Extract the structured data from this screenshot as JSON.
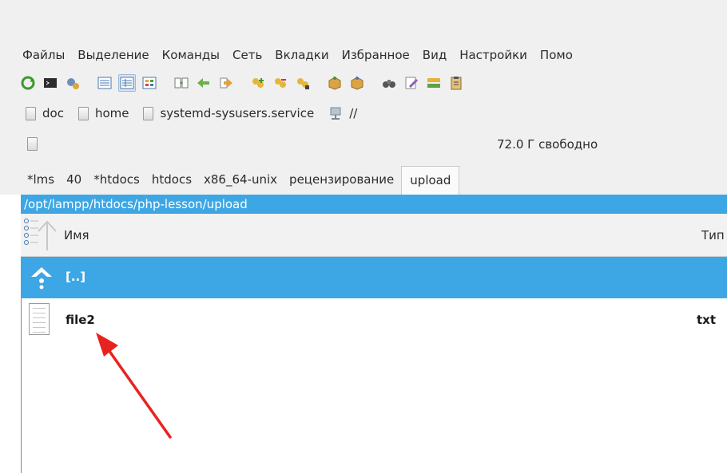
{
  "menu": [
    "Файлы",
    "Выделение",
    "Команды",
    "Сеть",
    "Вкладки",
    "Избранное",
    "Вид",
    "Настройки",
    "Помо"
  ],
  "drives": [
    {
      "label": "doc"
    },
    {
      "label": "home"
    },
    {
      "label": "systemd-sysusers.service"
    },
    {
      "label": "//"
    }
  ],
  "free_space": "72.0 Г свободно",
  "tabs": [
    "*lms",
    "40",
    "*htdocs",
    "htdocs",
    "x86_64-unix",
    "рецензирование",
    "upload"
  ],
  "active_tab": "upload",
  "path": "/opt/lampp/htdocs/php-lesson/upload",
  "columns": {
    "name": "Имя",
    "type": "Тип"
  },
  "rows": [
    {
      "name": "[..]",
      "ext": "",
      "selected": true
    },
    {
      "name": "file2",
      "ext": "txt",
      "selected": false
    }
  ],
  "colors": {
    "selection": "#3da7e6",
    "annotation_arrow": "#e8231f"
  }
}
